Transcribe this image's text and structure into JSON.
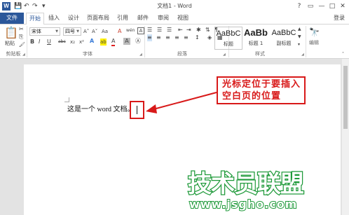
{
  "app": {
    "window_title": "文档1 - Word",
    "icon_letter": "W"
  },
  "quick_access": {
    "save": "💾",
    "undo": "↶",
    "redo": "↷",
    "customize": "▾"
  },
  "window_controls": {
    "help": "?",
    "ribbon_options": "▭",
    "minimize": "—",
    "maximize": "□",
    "close": "✕"
  },
  "tabs": [
    {
      "label": "文件"
    },
    {
      "label": "开始"
    },
    {
      "label": "插入"
    },
    {
      "label": "设计"
    },
    {
      "label": "页面布局"
    },
    {
      "label": "引用"
    },
    {
      "label": "邮件"
    },
    {
      "label": "审阅"
    },
    {
      "label": "视图"
    }
  ],
  "account": {
    "login_label": "登录"
  },
  "ribbon": {
    "clipboard": {
      "label": "剪贴板",
      "paste_label": "粘贴",
      "cut": "✂",
      "copy": "⎘",
      "format_painter": "🖌"
    },
    "font": {
      "label": "字体",
      "font_name": "宋体",
      "font_size": "四号",
      "grow": "A˄",
      "shrink": "A˅",
      "change_case": "Aa",
      "clear_format": "A",
      "phonetic": "wén",
      "enclose": "A",
      "bold": "B",
      "italic": "I",
      "underline": "U",
      "strike": "abc",
      "subscript": "x₂",
      "superscript": "x²",
      "text_effects": "A",
      "highlight": "ab",
      "font_color": "A",
      "char_shading": "A",
      "char_border": "Ⓐ"
    },
    "paragraph": {
      "label": "段落"
    },
    "styles": {
      "label": "样式",
      "items": [
        {
          "sample": "AaBbC",
          "name": "标题"
        },
        {
          "sample": "AaBb",
          "name": "标题 1"
        },
        {
          "sample": "AaBbC",
          "name": "副标题"
        }
      ]
    },
    "editing": {
      "label": "编辑",
      "icon": "🔭"
    }
  },
  "document": {
    "body_text": "这是一个 word 文档。",
    "callout_text": "光标定位于要插入空白页的位置"
  },
  "watermark": {
    "title": "技术员联盟",
    "url": "www.jsgho.com"
  },
  "colors": {
    "accent": "#2b579a",
    "annotation_red": "#d81919",
    "watermark_green": "#1f9a3a"
  }
}
